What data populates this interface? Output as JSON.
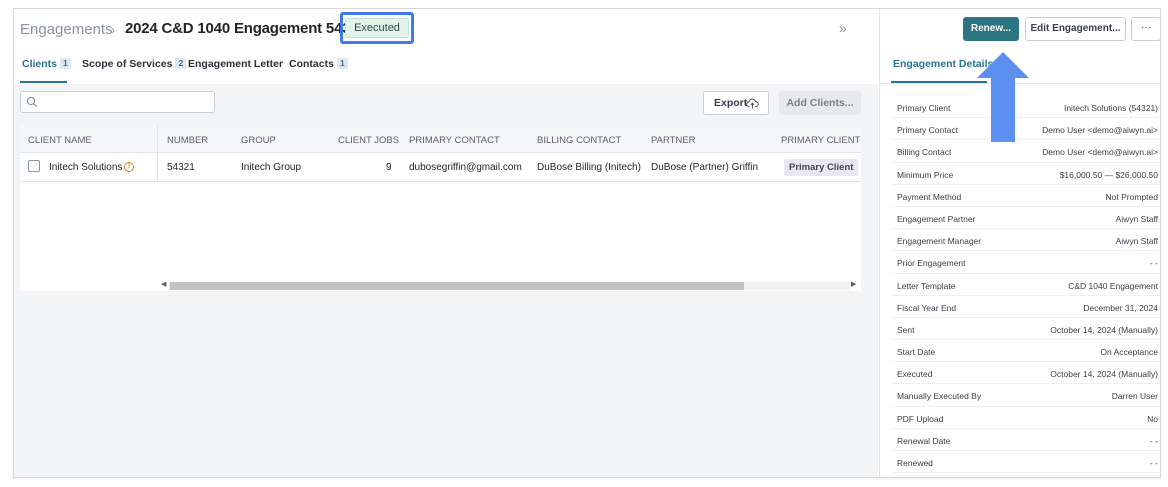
{
  "header": {
    "breadcrumb": "Engagements",
    "breadcrumb_separator": "›",
    "title": "2024 C&D 1040 Engagement 54321",
    "status": "Executed",
    "collapse_icon": "»"
  },
  "tabs": [
    {
      "label": "Clients",
      "count": "1"
    },
    {
      "label": "Scope of Services",
      "count": "2"
    },
    {
      "label": "Engagement Letter",
      "count": ""
    },
    {
      "label": "Contacts",
      "count": "1"
    }
  ],
  "toolbar": {
    "search_placeholder": "",
    "export_label": "Export",
    "add_clients_label": "Add Clients..."
  },
  "table": {
    "columns": [
      "CLIENT NAME",
      "NUMBER",
      "GROUP",
      "CLIENT JOBS",
      "PRIMARY CONTACT",
      "BILLING CONTACT",
      "PARTNER",
      "PRIMARY CLIENT"
    ],
    "rows": [
      {
        "client_name": "Initech Solutions",
        "warning_icon": "!",
        "number": "54321",
        "group": "Initech Group",
        "client_jobs": "9",
        "primary_contact": "dubosegriffin@gmail.com",
        "billing_contact": "DuBose Billing (Initech)",
        "partner": "DuBose (Partner) Griffin",
        "primary_client": "Primary Client"
      }
    ]
  },
  "side_panel": {
    "renew_label": "Renew...",
    "edit_label": "Edit Engagement...",
    "more_label": "···",
    "tab_label": "Engagement Details",
    "details": [
      {
        "key": "Primary Client",
        "value": "Initech Solutions (54321)"
      },
      {
        "key": "Primary Contact",
        "value": "Demo User <demo@aiwyn.ai>"
      },
      {
        "key": "Billing Contact",
        "value": "Demo User <demo@aiwyn.ai>"
      },
      {
        "key": "Minimum Price",
        "value": "$16,000.50 — $26,000.50"
      },
      {
        "key": "Payment Method",
        "value": "Not Prompted"
      },
      {
        "key": "Engagement Partner",
        "value": "Aiwyn Staff"
      },
      {
        "key": "Engagement Manager",
        "value": "Aiwyn Staff"
      },
      {
        "key": "Prior Engagement",
        "value": "- -"
      },
      {
        "key": "Letter Template",
        "value": "C&D 1040 Engagement"
      },
      {
        "key": "Fiscal Year End",
        "value": "December 31, 2024"
      },
      {
        "key": "Sent",
        "value": "October 14, 2024 (Manually)"
      },
      {
        "key": "Start Date",
        "value": "On Acceptance"
      },
      {
        "key": "Executed",
        "value": "October 14, 2024 (Manually)"
      },
      {
        "key": "Manually Executed By",
        "value": "Darren User"
      },
      {
        "key": "PDF Upload",
        "value": "No"
      },
      {
        "key": "Renewal Date",
        "value": "- -"
      },
      {
        "key": "Renewed",
        "value": "- -"
      }
    ]
  },
  "colors": {
    "accent": "#2a7391",
    "renew_button": "#2d7483",
    "highlight_outline": "#3d7be8",
    "annotation_arrow": "#5b8ff0",
    "status_badge_bg": "#e2f3ec"
  }
}
